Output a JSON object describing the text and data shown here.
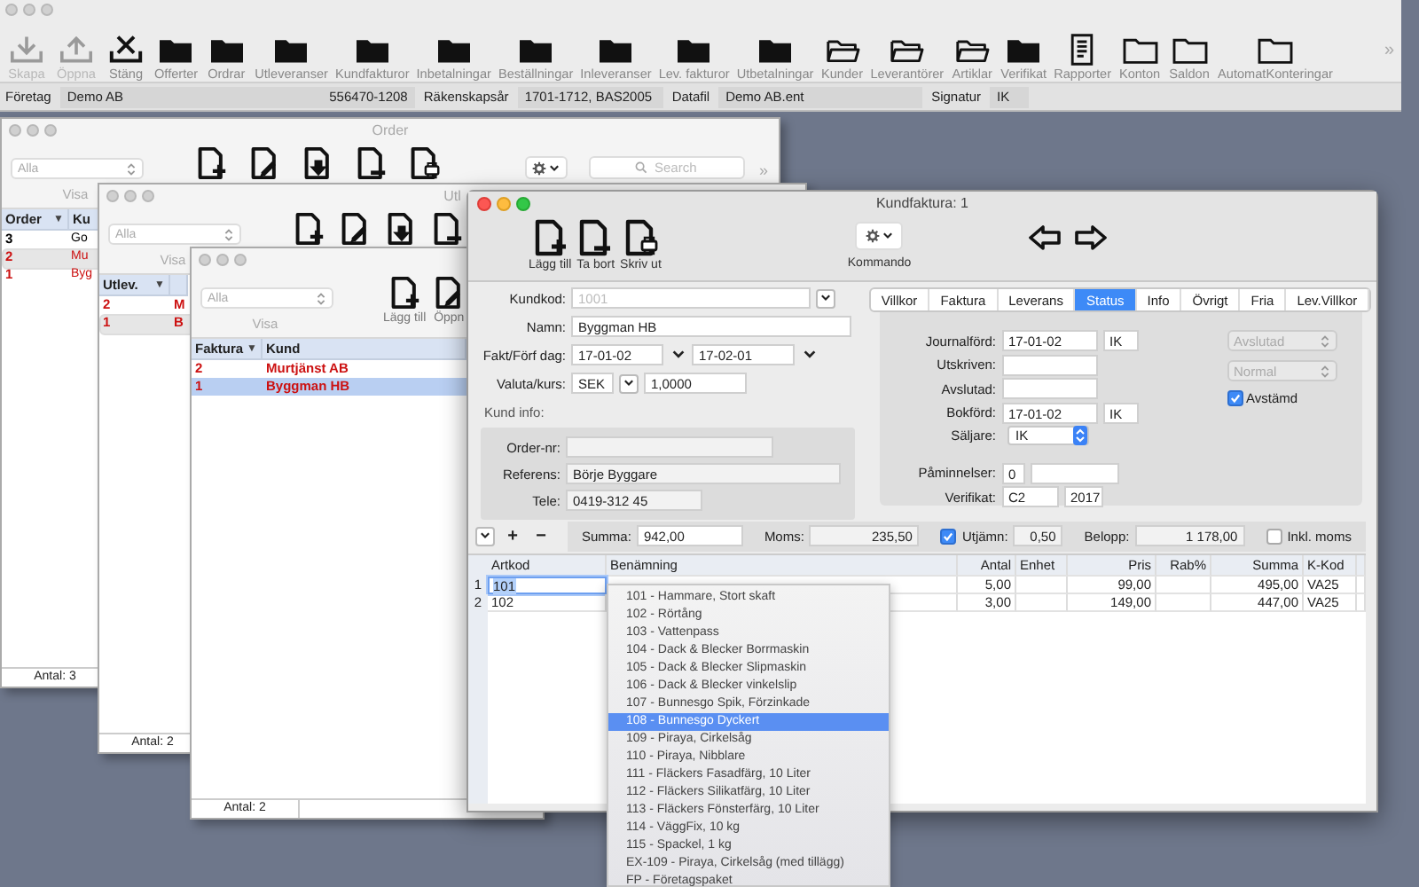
{
  "app_toolbar": {
    "items": [
      {
        "kind": "download",
        "label": "Skapa",
        "disabled": true
      },
      {
        "kind": "upload",
        "label": "Öppna",
        "disabled": true
      },
      {
        "kind": "close",
        "label": "Stäng",
        "disabled": false
      },
      {
        "kind": "folder",
        "label": "Offerter",
        "disabled": false
      },
      {
        "kind": "folder",
        "label": "Ordrar",
        "disabled": false
      },
      {
        "kind": "folder",
        "label": "Utleveranser",
        "disabled": false
      },
      {
        "kind": "folder",
        "label": "Kundfakturor",
        "disabled": false
      },
      {
        "kind": "folder",
        "label": "Inbetalningar",
        "disabled": false
      },
      {
        "kind": "folder",
        "label": "Beställningar",
        "disabled": false
      },
      {
        "kind": "folder",
        "label": "Inleveranser",
        "disabled": false
      },
      {
        "kind": "folder",
        "label": "Lev. fakturor",
        "disabled": false
      },
      {
        "kind": "folder",
        "label": "Utbetalningar",
        "disabled": false
      },
      {
        "kind": "folder-open",
        "label": "Kunder",
        "disabled": false
      },
      {
        "kind": "folder-open",
        "label": "Leverantörer",
        "disabled": false
      },
      {
        "kind": "folder-open",
        "label": "Artiklar",
        "disabled": false
      },
      {
        "kind": "folder",
        "label": "Verifikat",
        "disabled": false
      },
      {
        "kind": "report",
        "label": "Rapporter",
        "disabled": false
      },
      {
        "kind": "folder-outline",
        "label": "Konton",
        "disabled": false
      },
      {
        "kind": "folder-outline",
        "label": "Saldon",
        "disabled": false
      },
      {
        "kind": "folder-outline",
        "label": "AutomatKonteringar",
        "disabled": false
      }
    ],
    "overflow": "»"
  },
  "info_bar": {
    "company_label": "Företag",
    "company": "Demo AB",
    "org_number": "556470-1208",
    "fiscal_year_label": "Räkenskapsår",
    "fiscal_year": "1701-1712, BAS2005",
    "data_file_label": "Datafil",
    "data_file": "Demo AB.ent",
    "signature_label": "Signatur",
    "signature": "IK"
  },
  "list_windows": [
    {
      "title": "Order",
      "active": false,
      "list_active": false,
      "filter": "Alla",
      "filter_label": "Visa",
      "tools": [
        {
          "kind": "add"
        },
        {
          "kind": "edit"
        },
        {
          "kind": "download"
        },
        {
          "kind": "remove"
        },
        {
          "kind": "print"
        }
      ],
      "command_menu": true,
      "search_placeholder": "Search",
      "overflow": "»",
      "columns": [
        {
          "label": "Order",
          "sort_mark": "▼"
        },
        {
          "label": "Ku"
        }
      ],
      "rows": [
        {
          "cells": [
            "3",
            "Go"
          ],
          "color": "#000000",
          "selected": false
        },
        {
          "cells": [
            "2",
            "Mu"
          ],
          "color": "#cc1111",
          "selected": true
        },
        {
          "cells": [
            "1",
            "Byg"
          ],
          "color": "#cc1111",
          "selected": false
        }
      ],
      "footer": "Antal: 3"
    },
    {
      "title": "Utl",
      "active": false,
      "list_active": false,
      "filter": "Alla",
      "filter_label": "Visa",
      "tools": [
        {
          "kind": "add"
        },
        {
          "kind": "edit"
        },
        {
          "kind": "download"
        },
        {
          "kind": "remove"
        }
      ],
      "columns": [
        {
          "label": "Utlev.",
          "sort_mark": "▼"
        },
        {}
      ],
      "rows": [
        {
          "cells": [
            "2",
            "M"
          ],
          "color": "#cc1111",
          "selected": false
        },
        {
          "cells": [
            "1",
            "B"
          ],
          "color": "#cc1111",
          "selected": true
        }
      ],
      "footer": "Antal: 2"
    },
    {
      "active": false,
      "list_active": true,
      "filter": "Alla",
      "filter_label": "Visa",
      "tools": [
        {
          "kind": "add",
          "label": "Lägg till"
        },
        {
          "kind": "edit",
          "label": "Öppn"
        }
      ],
      "columns": [
        {
          "label": "Faktura",
          "sort_mark": "▼"
        },
        {
          "label": "Kund"
        }
      ],
      "rows": [
        {
          "cells": [
            "2",
            "Murtjänst AB"
          ],
          "color": "#cc1111",
          "selected": false
        },
        {
          "cells": [
            "1",
            "Byggman HB"
          ],
          "color": "#cc1111",
          "selected": true
        }
      ],
      "footer": "Antal: 2"
    }
  ],
  "invoice_window": {
    "title": "Kundfaktura: 1",
    "active": true,
    "tools": [
      {
        "kind": "add",
        "label": "Lägg till"
      },
      {
        "kind": "remove",
        "label": "Ta bort"
      },
      {
        "kind": "print",
        "label": "Skriv ut"
      }
    ],
    "command_label": "Kommando",
    "customer_code": {
      "label": "Kundkod:",
      "value": "1001",
      "disabled": true
    },
    "name": {
      "label": "Namn:",
      "value": "Byggman HB"
    },
    "dates": {
      "label": "Fakt/Förf dag:",
      "invoice_date": "17-01-02",
      "due_date": "17-02-01"
    },
    "currency": {
      "label": "Valuta/kurs:",
      "currency": "SEK",
      "rate": "1,0000"
    },
    "customer_info": {
      "title": "Kund info:",
      "fields": [
        {
          "label": "Order-nr:"
        },
        {
          "label": "Referens:",
          "value": "Börje Byggare"
        },
        {
          "label": "Tele:",
          "value": "0419-312 45"
        }
      ]
    },
    "tabs": [
      {
        "label": "Villkor",
        "selected": false
      },
      {
        "label": "Faktura",
        "selected": false
      },
      {
        "label": "Leverans",
        "selected": false
      },
      {
        "label": "Status",
        "selected": true
      },
      {
        "label": "Info",
        "selected": false
      },
      {
        "label": "Övrigt",
        "selected": false
      },
      {
        "label": "Fria",
        "selected": false
      },
      {
        "label": "Lev.Villkor",
        "selected": false
      }
    ],
    "status": {
      "rows": [
        {
          "label": "Journalförd:",
          "date": "17-01-02",
          "signature": "IK"
        },
        {
          "label": "Utskriven:"
        },
        {
          "label": "Avslutad:"
        },
        {
          "label": "Bokförd:",
          "date": "17-01-02",
          "signature": "IK"
        }
      ],
      "seller": {
        "label": "Säljare:",
        "value": "IK"
      },
      "reminders": {
        "label": "Påminnelser:",
        "count": "0"
      },
      "voucher": {
        "label": "Verifikat:",
        "series": "C2",
        "year": "2017"
      },
      "state_select": {
        "value": "Avslutad",
        "disabled": true
      },
      "priority_select": {
        "value": "Normal",
        "disabled": true
      },
      "reconciled": {
        "label": "Avstämd",
        "checked": true
      }
    },
    "summary": {
      "add": "+",
      "remove": "−",
      "sum_label": "Summa:",
      "sum": "942,00",
      "vat_label": "Moms:",
      "vat": "235,50",
      "rounding": {
        "label": "Utjämn:",
        "checked": true,
        "value": "0,50"
      },
      "amount_label": "Belopp:",
      "amount": "1 178,00",
      "incl_vat": {
        "label": "Inkl. moms",
        "checked": false
      }
    },
    "lines": {
      "columns": [
        "Artkod",
        "Benämning",
        "Antal",
        "Enhet",
        "Pris",
        "Rab%",
        "Summa",
        "K-Kod"
      ],
      "rows": [
        {
          "number": "1",
          "editing": true,
          "cells": [
            "101",
            null,
            "5,00",
            null,
            "99,00",
            null,
            "495,00",
            "VA25"
          ]
        },
        {
          "number": "2",
          "editing": false,
          "cells": [
            "102",
            null,
            "3,00",
            null,
            "149,00",
            null,
            "447,00",
            "VA25"
          ]
        }
      ]
    },
    "article_dropdown": [
      {
        "label": "101 - Hammare, Stort skaft",
        "selected": false
      },
      {
        "label": "102 - Rörtång",
        "selected": false
      },
      {
        "label": "103 - Vattenpass",
        "selected": false
      },
      {
        "label": "104 - Dack & Blecker Borrmaskin",
        "selected": false
      },
      {
        "label": "105 - Dack & Blecker Slipmaskin",
        "selected": false
      },
      {
        "label": "106 - Dack & Blecker vinkelslip",
        "selected": false
      },
      {
        "label": "107 - Bunnesgo Spik, Förzinkade",
        "selected": false
      },
      {
        "label": "108 - Bunnesgo Dyckert",
        "selected": true
      },
      {
        "label": "109 - Piraya, Cirkelsåg",
        "selected": false
      },
      {
        "label": "110 - Piraya, Nibblare",
        "selected": false
      },
      {
        "label": "111 - Fläckers Fasadfärg, 10 Liter",
        "selected": false
      },
      {
        "label": "112 - Fläckers Silikatfärg, 10 Liter",
        "selected": false
      },
      {
        "label": "113 - Fläckers Fönsterfärg, 10 Liter",
        "selected": false
      },
      {
        "label": "114 - VäggFix, 10 kg",
        "selected": false
      },
      {
        "label": "115 - Spackel, 1 kg",
        "selected": false
      },
      {
        "label": "EX-109 - Piraya, Cirkelsåg (med tillägg)",
        "selected": false
      },
      {
        "label": "FP - Företagspaket",
        "selected": false
      }
    ]
  }
}
